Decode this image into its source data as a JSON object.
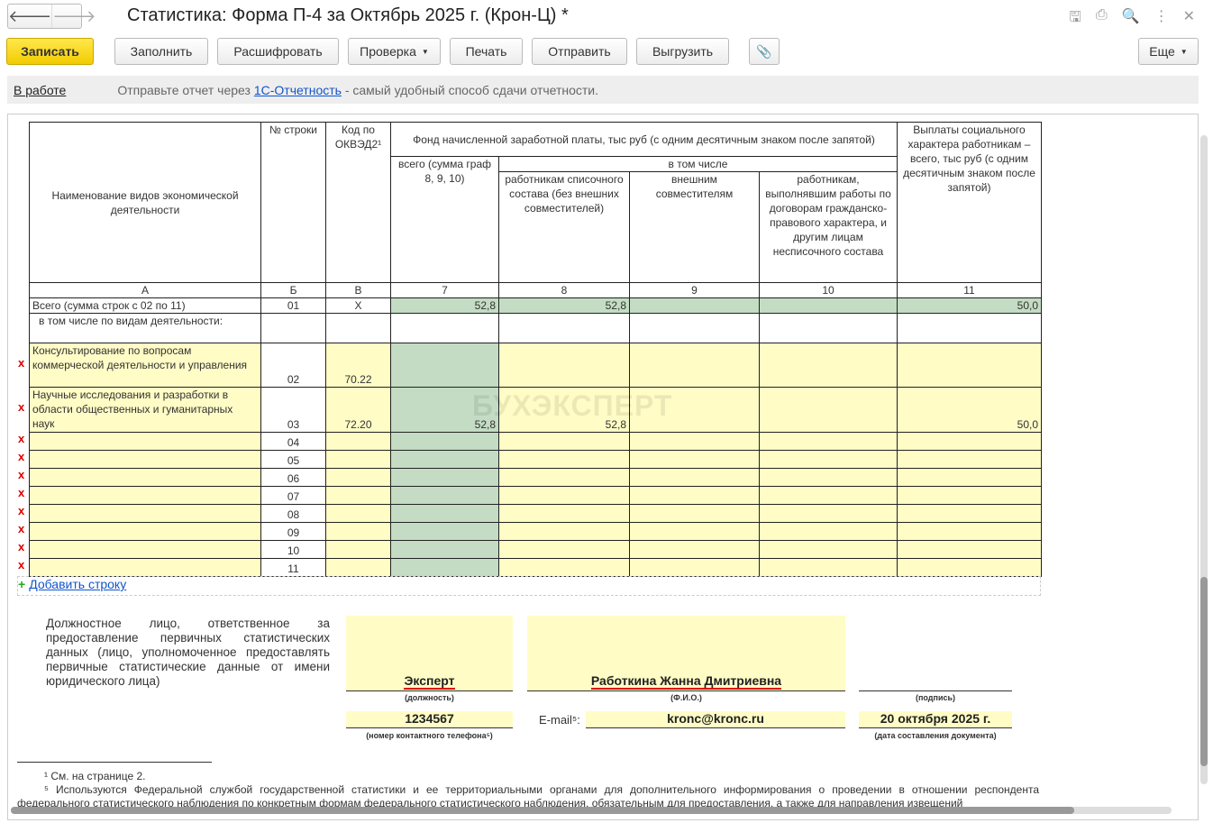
{
  "window": {
    "title": "Статистика: Форма П-4 за Октябрь 2025 г. (Крон-Ц) *"
  },
  "toolbar": {
    "save": "Записать",
    "fill": "Заполнить",
    "decode": "Расшифровать",
    "check": "Проверка",
    "print": "Печать",
    "send": "Отправить",
    "export": "Выгрузить",
    "more": "Еще"
  },
  "info": {
    "status": "В работе",
    "text_before": "Отправьте отчет через ",
    "link": "1С-Отчетность",
    "text_after": " - самый удобный способ сдачи отчетности."
  },
  "headers": {
    "name": "Наименование видов экономической деятельности",
    "row_no": "№ строки",
    "okved": "Код по ОКВЭД2¹",
    "fund": "Фонд начисленной заработной платы, тыс руб (с одним десятичным знаком после запятой)",
    "total": "всего (сумма граф 8, 9, 10)",
    "incl": "в том числе",
    "c8": "работникам списочного состава (без внешних совместителей)",
    "c9": "внешним совместителям",
    "c10": "работникам, выполнявшим работы по договорам гражданско-правового характера, и другим лицам несписочного состава",
    "c11": "Выплаты социального характера работникам – всего, тыс руб (с одним десятичным знаком после запятой)",
    "letters": [
      "А",
      "Б",
      "В",
      "7",
      "8",
      "9",
      "10",
      "11"
    ]
  },
  "total_row": {
    "name": "Всего (сумма строк с 02 по 11)",
    "no": "01",
    "code": "X",
    "c7": "52,8",
    "c8": "52,8",
    "c9": "",
    "c10": "",
    "c11": "50,0"
  },
  "subheader": "в том числе по видам деятельности:",
  "rows": [
    {
      "name": "Консультирование по вопросам коммерческой деятельности и управления",
      "no": "02",
      "code": "70.22",
      "c7": "",
      "c8": "",
      "c9": "",
      "c10": "",
      "c11": ""
    },
    {
      "name": "Научные исследования и разработки в области общественных и гуманитарных наук",
      "no": "03",
      "code": "72.20",
      "c7": "52,8",
      "c8": "52,8",
      "c9": "",
      "c10": "",
      "c11": "50,0"
    },
    {
      "name": "",
      "no": "04",
      "code": "",
      "c7": "",
      "c8": "",
      "c9": "",
      "c10": "",
      "c11": ""
    },
    {
      "name": "",
      "no": "05",
      "code": "",
      "c7": "",
      "c8": "",
      "c9": "",
      "c10": "",
      "c11": ""
    },
    {
      "name": "",
      "no": "06",
      "code": "",
      "c7": "",
      "c8": "",
      "c9": "",
      "c10": "",
      "c11": ""
    },
    {
      "name": "",
      "no": "07",
      "code": "",
      "c7": "",
      "c8": "",
      "c9": "",
      "c10": "",
      "c11": ""
    },
    {
      "name": "",
      "no": "08",
      "code": "",
      "c7": "",
      "c8": "",
      "c9": "",
      "c10": "",
      "c11": ""
    },
    {
      "name": "",
      "no": "09",
      "code": "",
      "c7": "",
      "c8": "",
      "c9": "",
      "c10": "",
      "c11": ""
    },
    {
      "name": "",
      "no": "10",
      "code": "",
      "c7": "",
      "c8": "",
      "c9": "",
      "c10": "",
      "c11": ""
    },
    {
      "name": "",
      "no": "11",
      "code": "",
      "c7": "",
      "c8": "",
      "c9": "",
      "c10": "",
      "c11": ""
    }
  ],
  "delete_mark": "x",
  "add_row": "Добавить строку",
  "watermark": "БУХЭКСПЕРТ",
  "signature": {
    "official_text": "Должностное лицо, ответственное за предоставление первичных статистических данных (лицо, уполномоченное предоставлять первичные статистические данные от имени юридического лица)",
    "position": "Эксперт",
    "position_cap": "(должность)",
    "fio": "Работкина Жанна Дмитриевна",
    "fio_cap": "(Ф.И.О.)",
    "sign_cap": "(подпись)",
    "phone": "1234567",
    "phone_cap": "(номер контактного телефона⁵)",
    "email_label": "E-mail⁵:",
    "email": "kronc@kronc.ru",
    "date": "20 октября 2025 г.",
    "date_cap": "(дата составления документа)"
  },
  "footnotes": [
    "¹ См. на странице 2.",
    "⁵ Используются Федеральной службой государственной статистики и ее территориальными органами для дополнительного информирования о проведении в отношении респондента федерального статистического наблюдения по конкретным формам федерального статистического наблюдения, обязательным для предоставления, а также для направления извещений"
  ],
  "colors": {
    "accent": "#f2cc00",
    "green": "#c3dcc3",
    "yellow": "#fffcc6",
    "link": "#1155cc"
  }
}
